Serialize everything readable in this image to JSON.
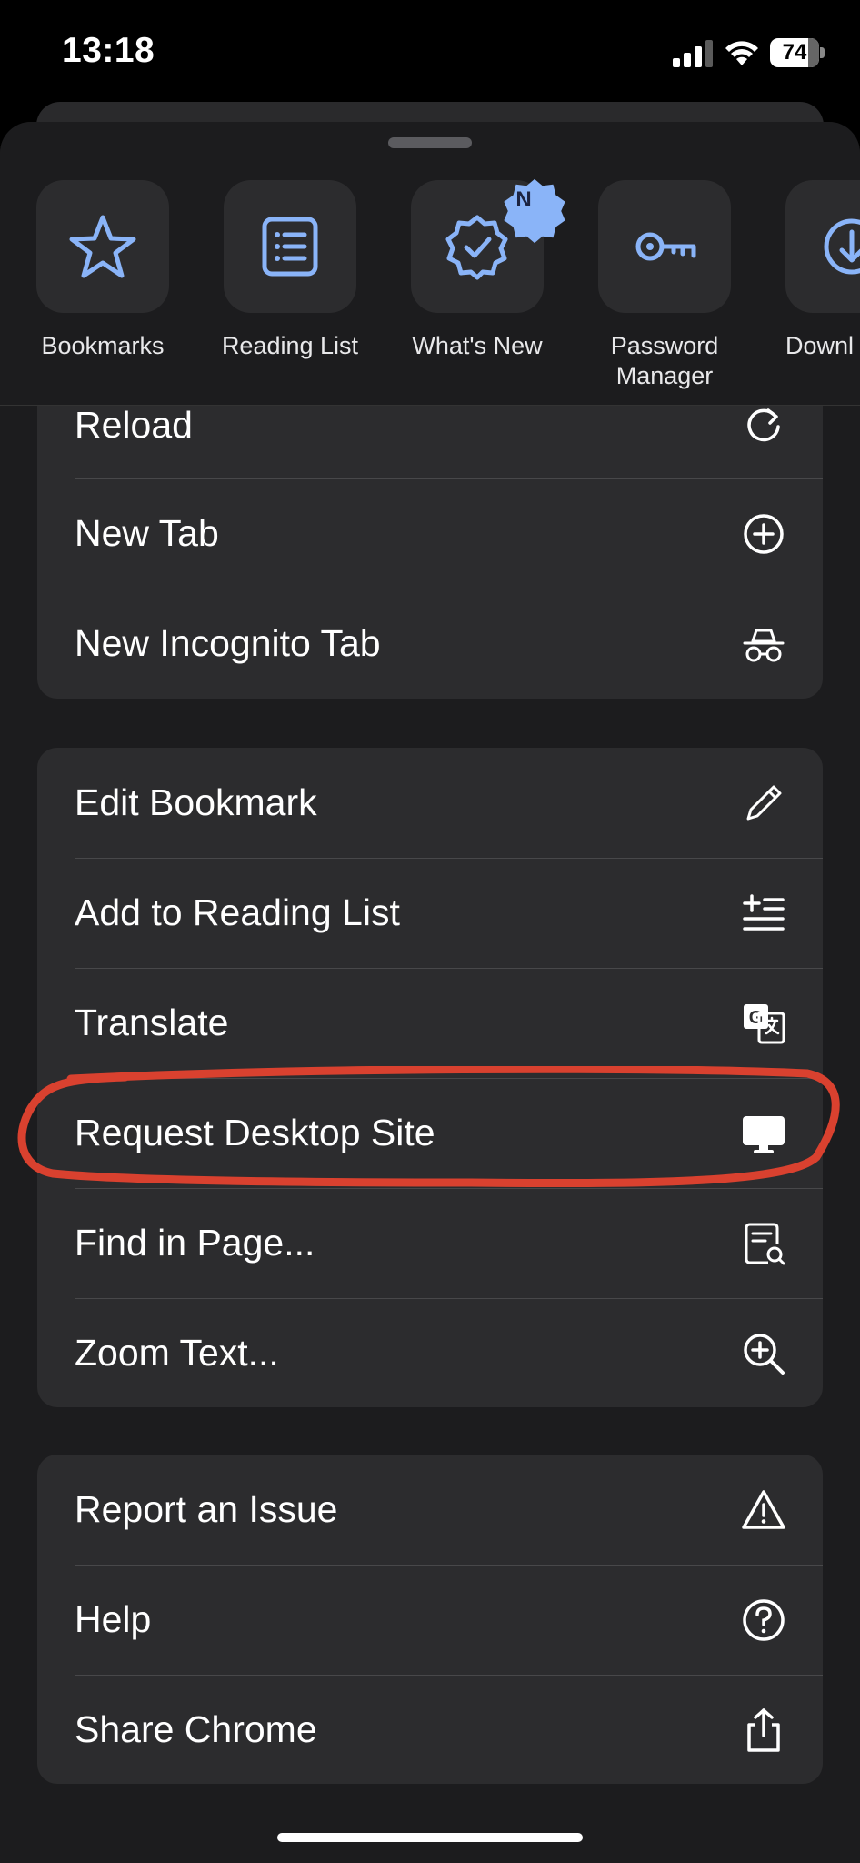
{
  "status_bar": {
    "time": "13:18",
    "battery": "74"
  },
  "quick_actions": [
    {
      "label": "Bookmarks",
      "icon": "star-icon"
    },
    {
      "label": "Reading List",
      "icon": "list-icon"
    },
    {
      "label": "What's New",
      "icon": "new-badge-icon",
      "badge": "N"
    },
    {
      "label": "Password\nManager",
      "icon": "key-icon"
    },
    {
      "label": "Downl",
      "icon": "download-icon"
    }
  ],
  "group1": [
    {
      "label": "Reload",
      "icon": "reload-icon"
    },
    {
      "label": "New Tab",
      "icon": "plus-circle-icon"
    },
    {
      "label": "New Incognito Tab",
      "icon": "incognito-icon"
    }
  ],
  "group2": [
    {
      "label": "Edit Bookmark",
      "icon": "pencil-icon"
    },
    {
      "label": "Add to Reading List",
      "icon": "add-list-icon"
    },
    {
      "label": "Translate",
      "icon": "translate-icon"
    },
    {
      "label": "Request Desktop Site",
      "icon": "desktop-icon"
    },
    {
      "label": "Find in Page...",
      "icon": "find-page-icon"
    },
    {
      "label": "Zoom Text...",
      "icon": "zoom-icon"
    }
  ],
  "group3": [
    {
      "label": "Report an Issue",
      "icon": "warning-icon"
    },
    {
      "label": "Help",
      "icon": "help-icon"
    },
    {
      "label": "Share Chrome",
      "icon": "share-icon"
    }
  ],
  "colors": {
    "accent": "#8ab4f8",
    "highlight": "#d9412f",
    "sheet": "#1c1c1e",
    "group": "#2c2c2e"
  }
}
